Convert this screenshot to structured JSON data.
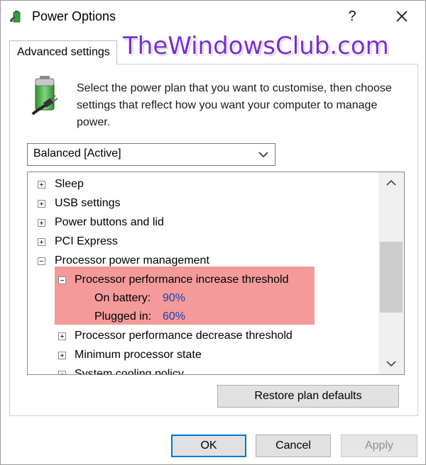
{
  "window": {
    "title": "Power Options",
    "help_glyph": "?",
    "close_glyph": "✕"
  },
  "tabs": [
    {
      "label": "Advanced settings",
      "selected": true
    }
  ],
  "watermark": "TheWindowsClub.com",
  "intro": "Select the power plan that you want to customise, then choose settings that reflect how you want your computer to manage power.",
  "plan_select": {
    "value": "Balanced [Active]"
  },
  "tree": {
    "items": [
      {
        "label": "Sleep",
        "state": "collapsed"
      },
      {
        "label": "USB settings",
        "state": "collapsed"
      },
      {
        "label": "Power buttons and lid",
        "state": "collapsed"
      },
      {
        "label": "PCI Express",
        "state": "collapsed"
      },
      {
        "label": "Processor power management",
        "state": "expanded"
      },
      {
        "label": "Processor performance increase threshold",
        "state": "expanded"
      },
      {
        "label": "Processor performance decrease threshold",
        "state": "collapsed"
      },
      {
        "label": "Minimum processor state",
        "state": "collapsed"
      },
      {
        "label": "System cooling policy",
        "state": "collapsed"
      }
    ],
    "on_battery": {
      "label": "On battery:",
      "value": "90%"
    },
    "plugged_in": {
      "label": "Plugged in:",
      "value": "60%"
    },
    "highlight_color": "#f49a9a"
  },
  "buttons": {
    "restore": "Restore plan defaults",
    "ok": "OK",
    "cancel": "Cancel",
    "apply": "Apply"
  },
  "colors": {
    "watermark": "#7a2ed1",
    "setting_value": "#1e3fae",
    "focus_border": "#0078d7"
  },
  "icons": [
    "power-options-icon",
    "battery-plug-icon",
    "chevron-down-icon",
    "expand-icon",
    "collapse-icon",
    "scroll-up-icon",
    "scroll-down-icon"
  ]
}
